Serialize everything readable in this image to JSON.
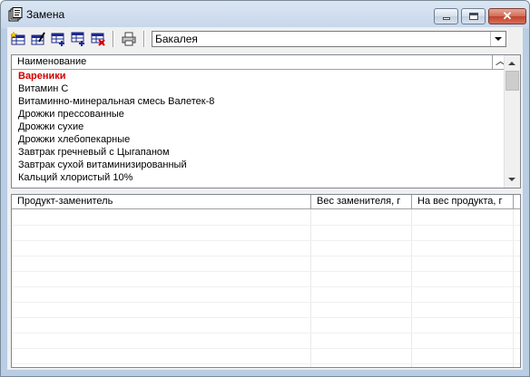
{
  "window": {
    "title": "Замена",
    "icon": "documents-icon",
    "controls": [
      "minimize",
      "maximize",
      "close"
    ]
  },
  "toolbar": {
    "buttons": [
      {
        "name": "add-record",
        "icon": "add-record-icon"
      },
      {
        "name": "edit-record",
        "icon": "edit-record-icon"
      },
      {
        "name": "add-row",
        "icon": "add-row-icon"
      },
      {
        "name": "insert-row",
        "icon": "insert-row-icon"
      },
      {
        "name": "delete-row",
        "icon": "delete-row-icon"
      },
      {
        "name": "print",
        "icon": "printer-icon"
      }
    ],
    "category_selected": "Бакалея"
  },
  "products": {
    "column_header": "Наименование",
    "items": [
      {
        "label": "Вареники",
        "selected": true
      },
      {
        "label": "Витамин С",
        "selected": false
      },
      {
        "label": "Витаминно-минеральная смесь Валетек-8",
        "selected": false
      },
      {
        "label": "Дрожжи прессованные",
        "selected": false
      },
      {
        "label": "Дрожжи сухие",
        "selected": false
      },
      {
        "label": "Дрожжи хлебопекарные",
        "selected": false
      },
      {
        "label": "Завтрак гречневый с Цыгапаном",
        "selected": false
      },
      {
        "label": "Завтрак сухой витаминизированный",
        "selected": false
      },
      {
        "label": "Кальций хлористый 10%",
        "selected": false
      }
    ]
  },
  "substitutes": {
    "columns": [
      "Продукт-заменитель",
      "Вес заменителя, г",
      "На вес продукта, г"
    ],
    "rows": []
  }
}
